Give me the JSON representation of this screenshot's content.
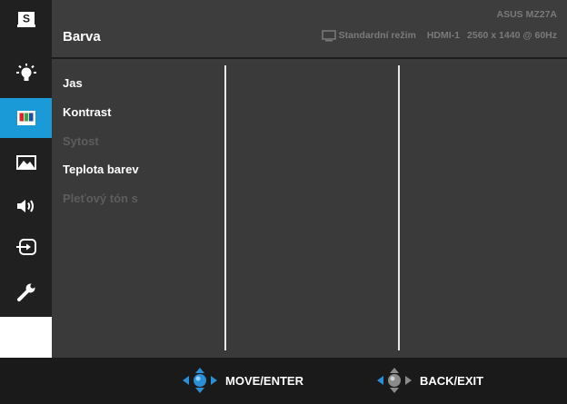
{
  "header": {
    "title": "Barva",
    "model": "ASUS MZ27A",
    "status": {
      "mode": "Standardní režim",
      "input": "HDMI-1",
      "resolution": "2560 x 1440 @ 60Hz"
    }
  },
  "sidebar": {
    "items": [
      {
        "name": "splendid",
        "icon": "s-badge-icon",
        "active": false
      },
      {
        "name": "blue-light-filter",
        "icon": "light-bulb-icon",
        "active": false
      },
      {
        "name": "color",
        "icon": "color-bars-icon",
        "active": true
      },
      {
        "name": "image",
        "icon": "landscape-image-icon",
        "active": false
      },
      {
        "name": "sound",
        "icon": "speaker-icon",
        "active": false
      },
      {
        "name": "input-select",
        "icon": "input-source-icon",
        "active": false
      },
      {
        "name": "system-setup",
        "icon": "wrench-icon",
        "active": false
      }
    ]
  },
  "menu": {
    "items": [
      {
        "label": "Jas",
        "enabled": true
      },
      {
        "label": "Kontrast",
        "enabled": true
      },
      {
        "label": "Sytost",
        "enabled": false
      },
      {
        "label": "Teplota barev",
        "enabled": true
      },
      {
        "label": "Pleťový tón s",
        "enabled": false
      }
    ]
  },
  "footer": {
    "move_label": "MOVE/ENTER",
    "back_label": "BACK/EXIT"
  },
  "colors": {
    "accent": "#1a9ad6",
    "panel": "#3d3d3d",
    "sidebar": "#202020",
    "footer": "#1a1a1a",
    "disabled_text": "#5d5d5d"
  }
}
